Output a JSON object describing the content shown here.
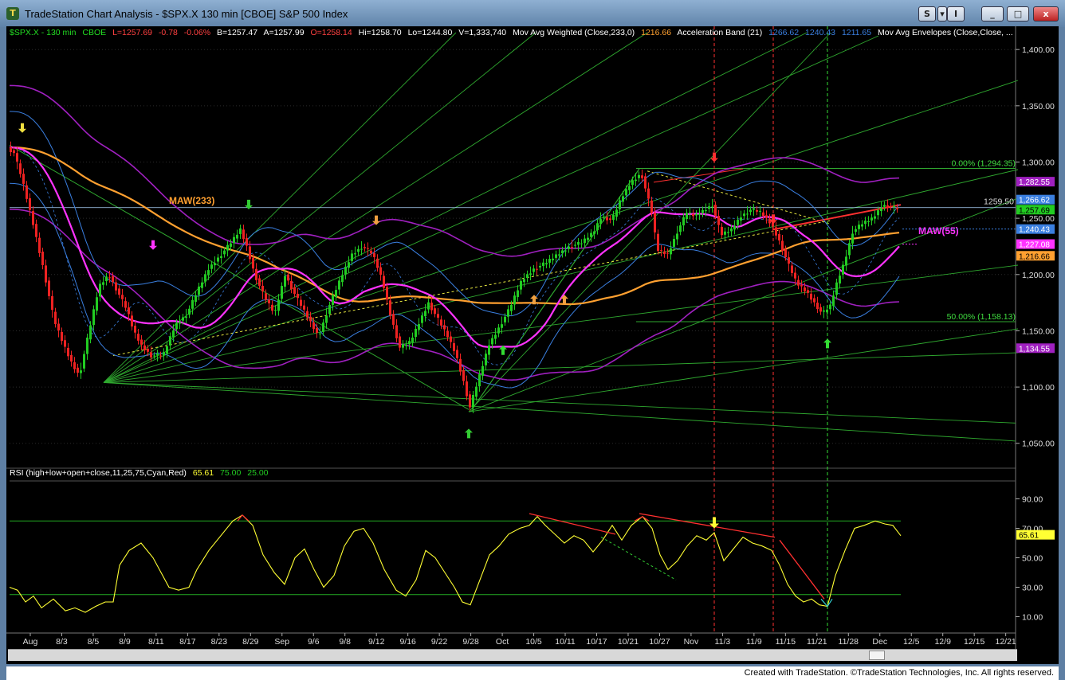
{
  "window": {
    "title": "TradeStation Chart Analysis - $SPX.X 130 min [CBOE] S&P 500 Index",
    "app_icon": "tradestation-logo-icon",
    "buttons": {
      "s_label": "S",
      "scroll_label": "I",
      "minimize_label": "_",
      "maximize_label": "□",
      "close_label": "x"
    }
  },
  "header": {
    "symbol": "$SPX.X - 130 min",
    "exchange": "CBOE",
    "last": "L=1257.69",
    "change": "-0.78",
    "pct": "-0.06%",
    "bid": "B=1257.47",
    "ask": "A=1257.99",
    "open": "O=1258.14",
    "high": "Hi=1258.70",
    "low": "Lo=1244.80",
    "volume": "V=1,333,740",
    "maw_label": "Mov Avg Weighted (Close,233,0)",
    "maw_value": "1216.66",
    "accel_label": "Acceleration Band (21)",
    "accel_v1": "1266.62",
    "accel_v2": "1240.43",
    "accel_v3": "1211.65",
    "env_label": "Mov Avg Envelopes (Close,Close, ..."
  },
  "rsi_header": {
    "label": "RSI (high+low+open+close,11,25,75,Cyan,Red)",
    "value": "65.61",
    "ob": "75.00",
    "os": "25.00"
  },
  "colors": {
    "bg": "#000000",
    "up": "#22cc22",
    "down": "#ee2222",
    "maw233": "#ffa030",
    "maw55": "#ff33ff",
    "env": "#a020c0",
    "accel": "#3a7fe0",
    "fan": "#2fa82f",
    "rsi": "#ffff33",
    "red_line": "#ff3030"
  },
  "chart_data": [
    {
      "type": "candlestick",
      "symbol": "$SPX.X",
      "interval": "130 min",
      "ylim": [
        1030,
        1415
      ],
      "yticks": [
        "1,400.00",
        "1,350.00",
        "1,300.00",
        "1,250.00",
        "1,200.00",
        "1,150.00",
        "1,100.00",
        "1,050.00"
      ],
      "ytick_values": [
        1400,
        1350,
        1300,
        1250,
        1200,
        1150,
        1100,
        1050
      ],
      "xticks": [
        "Aug",
        "8/3",
        "8/5",
        "8/9",
        "8/11",
        "8/17",
        "8/23",
        "8/29",
        "Sep",
        "9/6",
        "9/8",
        "9/12",
        "9/16",
        "9/22",
        "9/28",
        "Oct",
        "10/5",
        "10/11",
        "10/17",
        "10/21",
        "10/27",
        "Nov",
        "11/3",
        "11/9",
        "11/15",
        "11/21",
        "11/28",
        "Dec",
        "12/5",
        "12/9",
        "12/15",
        "12/21"
      ],
      "price_path": [
        [
          0,
          1313
        ],
        [
          8,
          1308
        ],
        [
          18,
          1285
        ],
        [
          32,
          1245
        ],
        [
          45,
          1205
        ],
        [
          58,
          1160
        ],
        [
          70,
          1138
        ],
        [
          80,
          1122
        ],
        [
          90,
          1110
        ],
        [
          103,
          1152
        ],
        [
          115,
          1190
        ],
        [
          127,
          1200
        ],
        [
          140,
          1182
        ],
        [
          150,
          1168
        ],
        [
          158,
          1150
        ],
        [
          168,
          1137
        ],
        [
          180,
          1128
        ],
        [
          195,
          1128
        ],
        [
          210,
          1155
        ],
        [
          225,
          1165
        ],
        [
          240,
          1188
        ],
        [
          252,
          1205
        ],
        [
          268,
          1218
        ],
        [
          280,
          1228
        ],
        [
          292,
          1240
        ],
        [
          300,
          1225
        ],
        [
          310,
          1200
        ],
        [
          322,
          1180
        ],
        [
          335,
          1165
        ],
        [
          348,
          1200
        ],
        [
          362,
          1180
        ],
        [
          378,
          1160
        ],
        [
          390,
          1145
        ],
        [
          405,
          1175
        ],
        [
          420,
          1200
        ],
        [
          432,
          1218
        ],
        [
          445,
          1225
        ],
        [
          458,
          1218
        ],
        [
          470,
          1195
        ],
        [
          480,
          1165
        ],
        [
          492,
          1135
        ],
        [
          505,
          1140
        ],
        [
          518,
          1160
        ],
        [
          528,
          1175
        ],
        [
          540,
          1160
        ],
        [
          552,
          1145
        ],
        [
          562,
          1130
        ],
        [
          572,
          1105
        ],
        [
          580,
          1082
        ],
        [
          592,
          1110
        ],
        [
          604,
          1138
        ],
        [
          618,
          1155
        ],
        [
          630,
          1170
        ],
        [
          645,
          1195
        ],
        [
          660,
          1205
        ],
        [
          675,
          1210
        ],
        [
          690,
          1218
        ],
        [
          705,
          1225
        ],
        [
          720,
          1228
        ],
        [
          735,
          1238
        ],
        [
          745,
          1252
        ],
        [
          758,
          1248
        ],
        [
          770,
          1268
        ],
        [
          782,
          1282
        ],
        [
          795,
          1290
        ],
        [
          808,
          1255
        ],
        [
          815,
          1222
        ],
        [
          828,
          1218
        ],
        [
          840,
          1238
        ],
        [
          852,
          1255
        ],
        [
          862,
          1252
        ],
        [
          875,
          1258
        ],
        [
          884,
          1262
        ],
        [
          895,
          1235
        ],
        [
          908,
          1240
        ],
        [
          920,
          1252
        ],
        [
          933,
          1258
        ],
        [
          945,
          1255
        ],
        [
          958,
          1245
        ],
        [
          968,
          1230
        ],
        [
          980,
          1208
        ],
        [
          990,
          1192
        ],
        [
          1002,
          1185
        ],
        [
          1012,
          1175
        ],
        [
          1022,
          1165
        ],
        [
          1032,
          1172
        ],
        [
          1040,
          1192
        ],
        [
          1050,
          1212
        ],
        [
          1060,
          1238
        ],
        [
          1072,
          1245
        ],
        [
          1085,
          1250
        ],
        [
          1098,
          1262
        ],
        [
          1108,
          1260
        ],
        [
          1118,
          1258
        ]
      ],
      "annotations": [
        "MAW(233)",
        "MAW(55)",
        "0.00% (1,294.35)",
        "50.00% (1,158.13)",
        "1259.50"
      ],
      "fib": [
        {
          "label": "0.00% (1,294.35)",
          "value": 1294.35
        },
        {
          "label": "50.00% (1,158.13)",
          "value": 1158.13
        }
      ],
      "hline_value": 1259.5,
      "hline_label": "1259.50",
      "price_boxes": [
        {
          "label": "1,282.55",
          "value": 1282.55,
          "color": "#a020c0"
        },
        {
          "label": "1,266.62",
          "value": 1266.62,
          "color": "#3a7fe0"
        },
        {
          "label": "1,257.69",
          "value": 1257.69,
          "color": "#22cc22"
        },
        {
          "label": "1,240.43",
          "value": 1240.43,
          "color": "#3a7fe0"
        },
        {
          "label": "1,227.08",
          "value": 1227.08,
          "color": "#ff33ff"
        },
        {
          "label": "1,216.66",
          "value": 1216.66,
          "color": "#ffa030"
        },
        {
          "label": "1,134.55",
          "value": 1134.55,
          "color": "#a020c0"
        }
      ],
      "arrow_names": [
        "down-arrow-yellow",
        "down-arrow-green",
        "down-arrow-magenta",
        "down-arrow-orange",
        "up-arrow-orange",
        "up-arrow-orange-2",
        "up-arrow-green",
        "up-arrow-green-2",
        "down-arrow-red",
        "down-arrow-red-2",
        "up-arrow-green-3"
      ]
    },
    {
      "type": "line",
      "name": "RSI",
      "ylim": [
        0,
        100
      ],
      "yticks": [
        "90.00",
        "70.00",
        "50.00",
        "30.00",
        "10.00"
      ],
      "ytick_values": [
        90,
        70,
        50,
        30,
        10
      ],
      "levels": [
        75,
        25
      ],
      "last_label": "65.61",
      "last_value": 65.61,
      "path": [
        [
          0,
          30
        ],
        [
          10,
          28
        ],
        [
          20,
          20
        ],
        [
          30,
          24
        ],
        [
          40,
          16
        ],
        [
          55,
          22
        ],
        [
          70,
          14
        ],
        [
          82,
          16
        ],
        [
          95,
          13
        ],
        [
          108,
          17
        ],
        [
          120,
          20
        ],
        [
          130,
          20
        ],
        [
          138,
          45
        ],
        [
          150,
          55
        ],
        [
          165,
          60
        ],
        [
          180,
          50
        ],
        [
          190,
          40
        ],
        [
          200,
          30
        ],
        [
          212,
          28
        ],
        [
          225,
          30
        ],
        [
          235,
          42
        ],
        [
          250,
          55
        ],
        [
          265,
          65
        ],
        [
          280,
          75
        ],
        [
          292,
          79
        ],
        [
          305,
          72
        ],
        [
          318,
          52
        ],
        [
          332,
          40
        ],
        [
          345,
          32
        ],
        [
          358,
          50
        ],
        [
          370,
          56
        ],
        [
          382,
          42
        ],
        [
          394,
          30
        ],
        [
          407,
          38
        ],
        [
          420,
          58
        ],
        [
          432,
          68
        ],
        [
          444,
          70
        ],
        [
          456,
          60
        ],
        [
          470,
          42
        ],
        [
          485,
          28
        ],
        [
          497,
          24
        ],
        [
          510,
          35
        ],
        [
          522,
          55
        ],
        [
          534,
          50
        ],
        [
          546,
          40
        ],
        [
          558,
          30
        ],
        [
          568,
          20
        ],
        [
          578,
          18
        ],
        [
          590,
          35
        ],
        [
          602,
          52
        ],
        [
          614,
          58
        ],
        [
          626,
          66
        ],
        [
          640,
          70
        ],
        [
          652,
          72
        ],
        [
          662,
          78
        ],
        [
          672,
          72
        ],
        [
          684,
          66
        ],
        [
          696,
          60
        ],
        [
          708,
          65
        ],
        [
          720,
          62
        ],
        [
          732,
          54
        ],
        [
          744,
          62
        ],
        [
          756,
          72
        ],
        [
          768,
          62
        ],
        [
          780,
          72
        ],
        [
          794,
          78
        ],
        [
          806,
          70
        ],
        [
          816,
          52
        ],
        [
          826,
          42
        ],
        [
          838,
          48
        ],
        [
          850,
          58
        ],
        [
          862,
          65
        ],
        [
          874,
          62
        ],
        [
          884,
          67
        ],
        [
          896,
          48
        ],
        [
          908,
          56
        ],
        [
          920,
          64
        ],
        [
          932,
          60
        ],
        [
          944,
          58
        ],
        [
          956,
          55
        ],
        [
          966,
          45
        ],
        [
          976,
          32
        ],
        [
          986,
          24
        ],
        [
          996,
          20
        ],
        [
          1006,
          22
        ],
        [
          1016,
          18
        ],
        [
          1026,
          17
        ],
        [
          1036,
          38
        ],
        [
          1048,
          55
        ],
        [
          1060,
          70
        ],
        [
          1072,
          72
        ],
        [
          1086,
          75
        ],
        [
          1098,
          73
        ],
        [
          1108,
          72
        ],
        [
          1118,
          65
        ]
      ]
    }
  ]
}
